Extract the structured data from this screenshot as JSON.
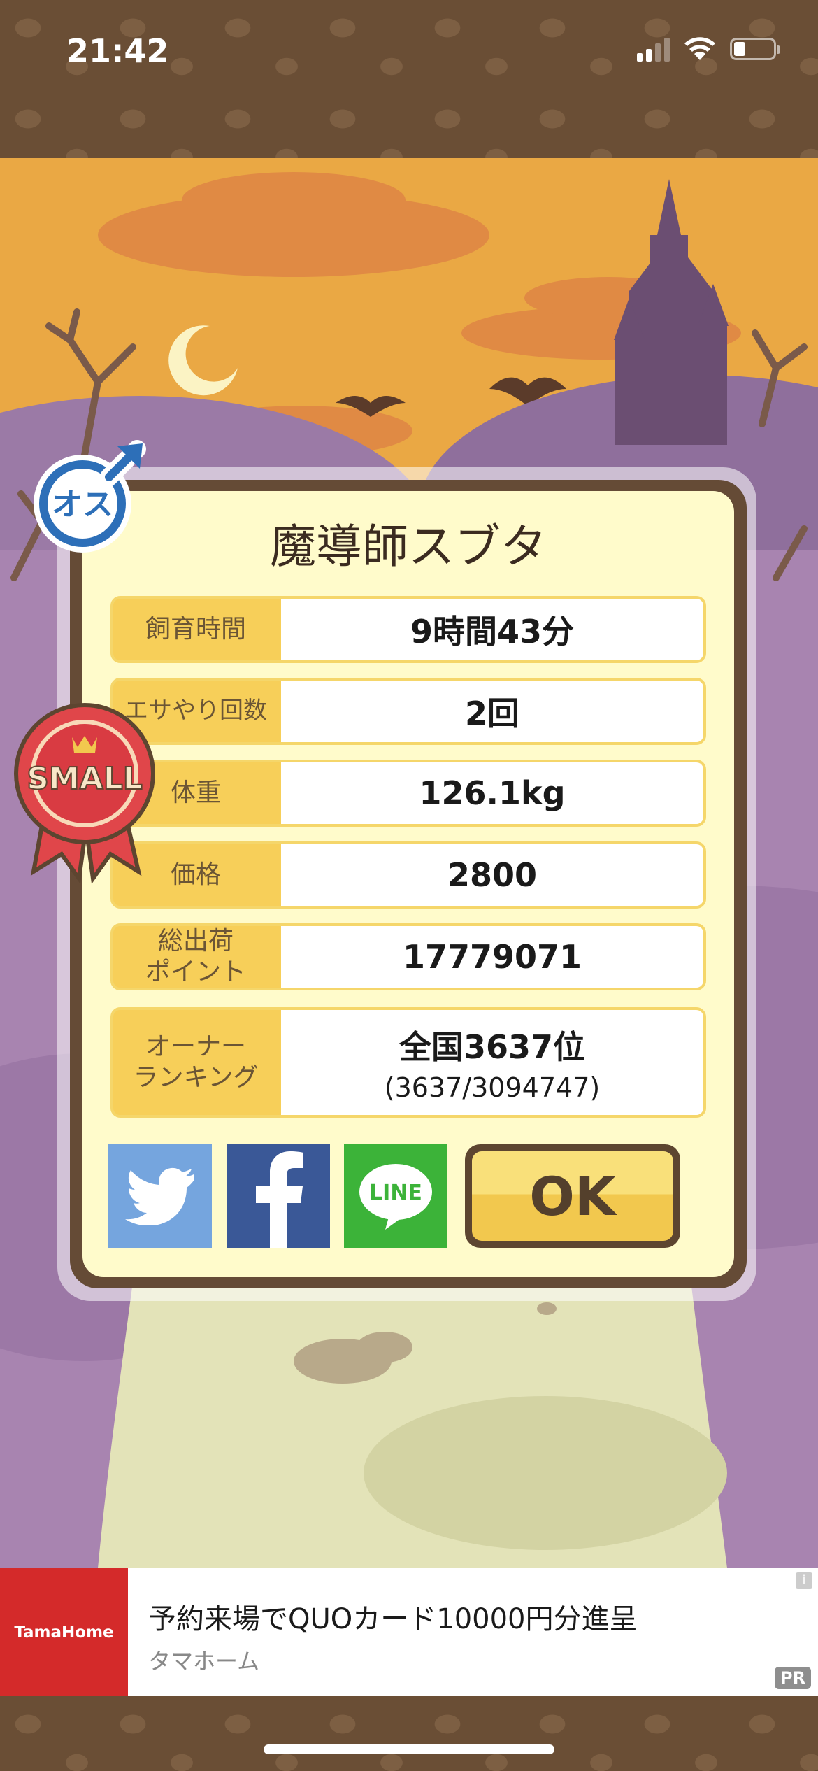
{
  "status_bar": {
    "time": "21:42"
  },
  "card": {
    "pig_name": "魔導師スブタ",
    "gender_badge": "オス",
    "size_ribbon": "SMALL",
    "stats": [
      {
        "label": "飼育時間",
        "value": "9時間43分"
      },
      {
        "label": "エサやり回数",
        "value": "2回"
      },
      {
        "label": "体重",
        "value": "126.1kg"
      },
      {
        "label": "価格",
        "value": "2800"
      },
      {
        "label": "総出荷\nポイント",
        "value": "17779071"
      },
      {
        "label": "オーナー\nランキング",
        "value": "全国3637位",
        "sub": "(3637/3094747)"
      }
    ],
    "share": {
      "line_label": "LINE"
    },
    "ok_label": "OK"
  },
  "ad": {
    "brand": "TamaHome",
    "title": "予約来場でQUOカード10000円分進呈",
    "advertiser": "タマホーム",
    "pr_label": "PR",
    "info_label": "i"
  },
  "colors": {
    "accent": "#f7cf59",
    "card_border": "#654b36",
    "card_bg": "#fffbcb",
    "twitter": "#75a5de",
    "facebook": "#3a5897",
    "line": "#3cb339"
  }
}
